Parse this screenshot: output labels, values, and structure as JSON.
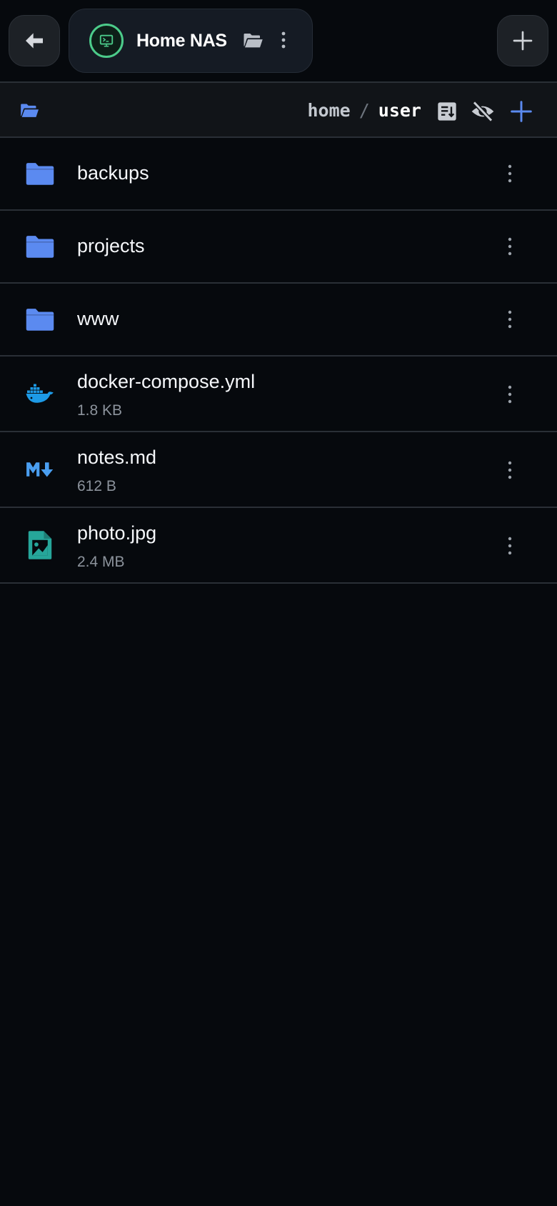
{
  "topbar": {
    "back_icon": "arrow-left-icon",
    "session": {
      "title": "Home NAS",
      "avatar_icon": "terminal-icon",
      "folder_icon": "folder-open-icon",
      "more_icon": "more-vert-icon"
    },
    "add_tab_icon": "plus-icon"
  },
  "pathbar": {
    "root_icon": "folder-open-icon",
    "crumbs": [
      "home",
      "user"
    ],
    "separator": "/",
    "actions": [
      "sort-icon",
      "eye-off-icon",
      "plus-icon"
    ]
  },
  "files": [
    {
      "name": "backups",
      "type": "folder",
      "icon": "folder-icon"
    },
    {
      "name": "projects",
      "type": "folder",
      "icon": "folder-icon"
    },
    {
      "name": "www",
      "type": "folder",
      "icon": "folder-icon"
    },
    {
      "name": "docker-compose.yml",
      "size": "1.8 KB",
      "type": "file",
      "icon": "docker-icon"
    },
    {
      "name": "notes.md",
      "size": "612 B",
      "type": "file",
      "icon": "markdown-icon"
    },
    {
      "name": "photo.jpg",
      "size": "2.4 MB",
      "type": "file",
      "icon": "image-file-icon"
    }
  ],
  "colors": {
    "background": "#06090d",
    "folder": "#5b8af0",
    "docker": "#1d9ae6",
    "markdown": "#4a9ef0",
    "image": "#26a69a",
    "accent_green": "#4ccb8a",
    "accent_blue": "#5b8af0"
  }
}
